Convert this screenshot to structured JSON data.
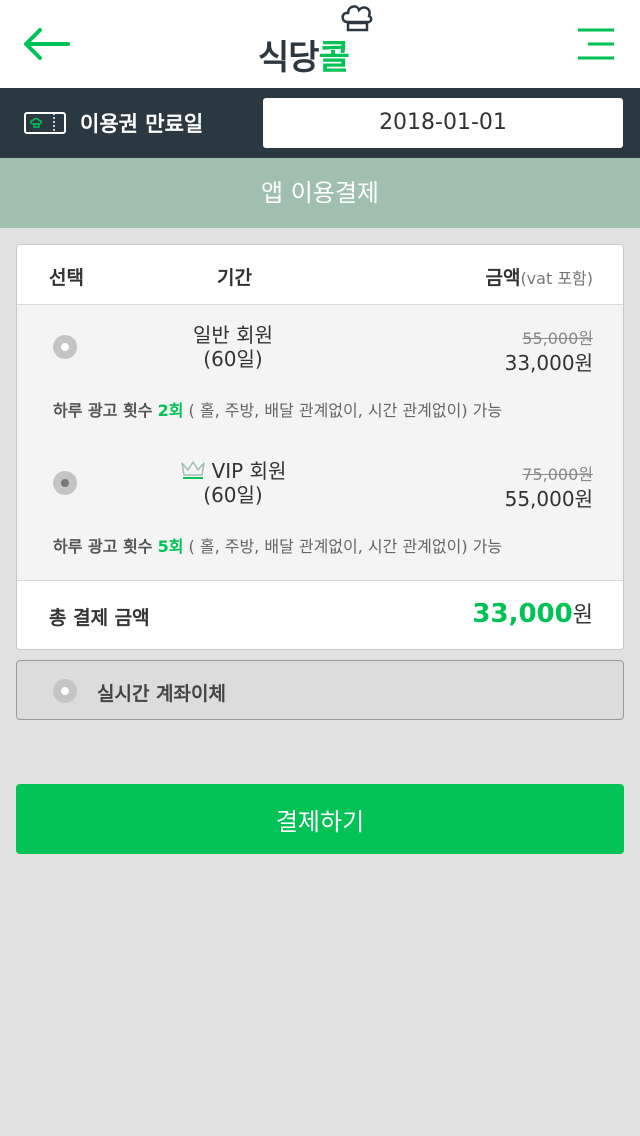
{
  "header": {
    "logo_text_a": "식당",
    "logo_text_b": "콜",
    "brand_color": "#00c255",
    "back_icon": "arrow-left-icon",
    "menu_icon": "hamburger-menu-icon"
  },
  "expiry": {
    "icon": "ticket-icon",
    "label": "이용권 만료일",
    "date": "2018-01-01"
  },
  "section_title": "앱 이용결제",
  "table": {
    "headers": {
      "select": "선택",
      "period": "기간",
      "amount": "금액",
      "amount_note": "(vat 포함)"
    },
    "plans": [
      {
        "name": "일반 회원",
        "period": "(60일)",
        "original_price": "55,000원",
        "price": "33,000원",
        "desc_prefix": "하루 광고 횟수",
        "desc_count": "2회",
        "desc_suffix": "( 홀, 주방, 배달 관계없이, 시간 관계없이) 가능",
        "selected": false
      },
      {
        "name": "VIP 회원",
        "icon": "crown-icon",
        "period": "(60일)",
        "original_price": "75,000원",
        "price": "55,000원",
        "desc_prefix": "하루 광고 횟수",
        "desc_count": "5회",
        "desc_suffix": "( 홀, 주방, 배달 관계없이, 시간 관계없이) 가능",
        "selected": true
      }
    ],
    "total": {
      "label": "총 결제 금액",
      "amount": "33,000",
      "unit": "원"
    }
  },
  "payment_method": {
    "label": "실시간 계좌이체"
  },
  "pay_button": "결제하기"
}
